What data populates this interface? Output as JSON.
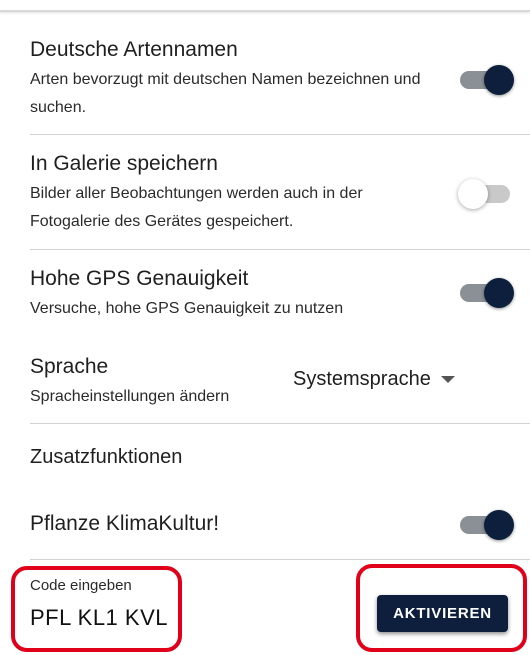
{
  "settings": {
    "german_names": {
      "title": "Deutsche Artennamen",
      "subtitle": "Arten bevorzugt mit deutschen Namen bezeichnen und suchen.",
      "enabled": true
    },
    "save_gallery": {
      "title": "In Galerie speichern",
      "subtitle": "Bilder aller Beobachtungen werden auch in der Fotogalerie des Gerätes gespeichert.",
      "enabled": false
    },
    "gps_accuracy": {
      "title": "Hohe GPS Genauigkeit",
      "subtitle": "Versuche, hohe GPS Genauigkeit zu nutzen",
      "enabled": true
    },
    "language": {
      "title": "Sprache",
      "subtitle": "Spracheinstellungen ändern",
      "selected": "Systemsprache"
    }
  },
  "extras": {
    "section_title": "Zusatzfunktionen",
    "klimakultur": {
      "title": "Pflanze KlimaKultur!",
      "enabled": true
    },
    "code": {
      "label": "Code eingeben",
      "value": "PFL KL1 KVL"
    },
    "activate_label": "AKTIVIEREN"
  },
  "colors": {
    "accent": "#0d1f3c",
    "highlight": "#e0001a"
  },
  "icons": {
    "dropdown": "caret-down-icon"
  }
}
